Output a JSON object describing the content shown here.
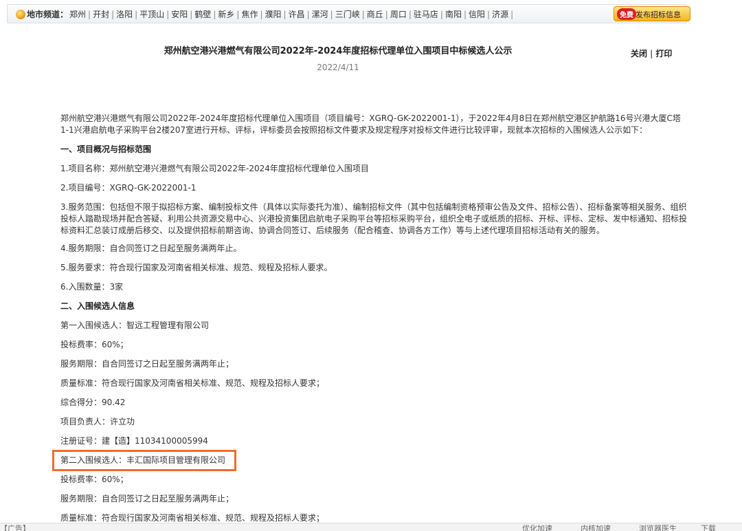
{
  "citybar": {
    "label": "地市频道：",
    "cities": [
      "郑州",
      "开封",
      "洛阳",
      "平顶山",
      "安阳",
      "鹤壁",
      "新乡",
      "焦作",
      "濮阳",
      "许昌",
      "漯河",
      "三门峡",
      "商丘",
      "周口",
      "驻马店",
      "南阳",
      "信阳",
      "济源"
    ],
    "publish_free": "免费",
    "publish_label": "发布招标信息"
  },
  "article": {
    "title": "郑州航空港兴港燃气有限公司2022年-2024年度招标代理单位入围项目中标候选人公示",
    "date": "2022/4/11",
    "close_label": "关闭",
    "print_label": "打印",
    "separator": "|"
  },
  "content": {
    "intro": "郑州航空港兴港燃气有限公司2022年-2024年度招标代理单位入围项目（项目编号：XGRQ-GK-2022001-1），于2022年4月8日在郑州航空港区护航路16号兴港大厦C塔1-1兴港启航电子采购平台2楼207室进行开标、评标，评标委员会按照招标文件要求及规定程序对投标文件进行比较评审，现就本次招标的入围候选人公示如下：",
    "section1": "一、项目概况与招标范围",
    "item1": "1.项目名称：郑州航空港兴港燃气有限公司2022年-2024年度招标代理单位入围项目",
    "item2": "2.项目编号：XGRQ-GK-2022001-1",
    "item3": "3.服务范围：包括但不限于拟招标方案、编制投标文件（具体以实际委托为准）、编制招标文件（其中包括编制资格预审公告及文件、招标公告）、招标备案等相关服务、组织投标人踏勘现场并配合答疑、利用公共资源交易中心、兴港投资集团启航电子采购平台等招标采购平台，组织全电子或纸质的招标、开标、评标、定标、发中标通知、招标投标资料汇总装订成册后移交、以及提供招标前期咨询、协调合同签订、后续服务（配合稽查、协调各方工作）等与上述代理项目招标活动有关的服务。",
    "item4": "4.服务期限：自合同签订之日起至服务满两年止。",
    "item5": "5.服务要求：符合现行国家及河南省相关标准、规范、规程及招标人要求。",
    "item6": "6.入围数量：3家",
    "section2": "二、入围候选人信息",
    "c1_name": "第一入围候选人：智远工程管理有限公司",
    "c1_rate": "投标费率：60%；",
    "c1_period": "服务期限：自合同签订之日起至服务满两年止；",
    "c1_quality": "质量标准：符合现行国家及河南省相关标准、规范、规程及招标人要求；",
    "c1_score": "综合得分：90.42",
    "c1_manager": "项目负责人：许立功",
    "c1_cert": "注册证号：建【造】11034100005994",
    "c2_name": "第二入围候选人：丰汇国际项目管理有限公司",
    "c2_rate": "投标费率：60%；",
    "c2_period": "服务期限：自合同签订之日起至服务满两年止；",
    "c2_quality": "质量标准：符合现行国家及河南省相关标准、规范、规程及招标人要求；"
  },
  "statusbar": {
    "left": "【广告】",
    "items": [
      "优化加速",
      "内核加速",
      "浏览器医生",
      "下载"
    ]
  }
}
